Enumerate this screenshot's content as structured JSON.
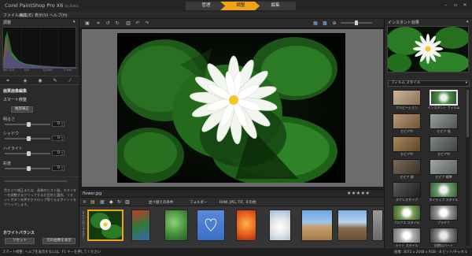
{
  "app": {
    "title": "Corel PaintShop Pro X6",
    "title_suffix": "by Stella",
    "modes": [
      "管理",
      "調整",
      "編集"
    ],
    "active_mode": "調整"
  },
  "menu": [
    "ファイル(F)",
    "編集(E)",
    "表示(V)",
    "ヘルプ(H)"
  ],
  "left": {
    "header": "調整",
    "histogram_stats": [
      "ISO 125",
      "f/11",
      "1/1250",
      "3 mm"
    ],
    "section_title": "画質画像編集",
    "smart_fix": {
      "title": "スマート修整",
      "button": "推奨補正"
    },
    "sliders": [
      {
        "label": "明るさ",
        "value": "0",
        "position": 0.5
      },
      {
        "label": "シャドウ",
        "value": "0",
        "position": 0.5
      },
      {
        "label": "ハイライト",
        "value": "0",
        "position": 0.5
      },
      {
        "label": "彩度",
        "value": "0",
        "position": 0.5
      }
    ],
    "help_text": "色かぶり補正または、画像のヒスト図。スライダーを調整するクリックするか目的と選択。リセットボタンを押すかドロップ等でえるポイントをクリックします。",
    "white_balance": {
      "title": "ホワイトバランス",
      "buttons": [
        "リセット",
        "元の画像を表示"
      ]
    }
  },
  "toolbar": {
    "icons": [
      "save-icon",
      "crop-icon",
      "rotate-left-icon",
      "rotate-right-icon",
      "delete-icon",
      "undo-icon",
      "redo-icon"
    ],
    "right_icons": [
      "fit-icon",
      "actual-size-icon",
      "zoom-icon"
    ]
  },
  "filmstrip": {
    "filename": "flower.jpg",
    "rating": "★★★★★",
    "toolbar_labels": [
      "並べ替えの条件",
      "フォルダー",
      "RAW, JPG, TIF, その他"
    ],
    "side_label": "すべてのフォルダー"
  },
  "right": {
    "header": "インスタント効果",
    "category": "フィルム スタイル",
    "styles": [
      "アルビーション",
      "インスタント フィルム",
      "セピア中",
      "セピア 強",
      "セピア中",
      "セピア中",
      "セピア 弱",
      "セピア 標準",
      "ダゲレオタイプ",
      "ネイティブ スタイル",
      "ブロクス スタイル",
      "プラチナ",
      "ライト スタイル",
      "初期ロバート",
      "",
      ""
    ]
  },
  "status": {
    "left": "スマート修整: ヘルプを表示するには、F1 キーを押してください",
    "right": "画像: 3072 x 2048 x RGB - 8 ビット/チャネル"
  },
  "colors": {
    "accent": "#f0a316",
    "panel": "#2a2a2a",
    "canvas_bg": "#6c6c6c"
  }
}
